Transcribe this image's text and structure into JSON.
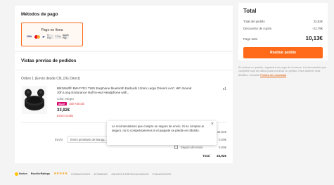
{
  "payment": {
    "title": "Métodos de pago",
    "option_label": "Pago en línea",
    "logos": [
      "VISA",
      "mastercard",
      "P",
      "G Pay",
      "C Pay",
      "Apple Pay"
    ]
  },
  "preview": {
    "title": "Vistas previas de pedidos",
    "order_title": "Orden 1 (Envío desde CN_DG Direct)",
    "product": {
      "name": "BlitzWolf® BW-FYE2 TWS Earphone bluetooth Earbuds 13mm Large Drivers AAC HiFi Sound 20h Long Endurance Half in-ear Headphone with...",
      "color": "color: Negro",
      "sale_badge": "SALE",
      "stock_left": "150 Artículo",
      "price": "33,92€",
      "shipping": "Envío Gratis",
      "qty": "x1"
    },
    "subtotal_value": "33,92€",
    "shipping_label": "Envío",
    "shipping_method": "Envío prioritario de Bangg...",
    "shipping_cost": "0,00€",
    "insurance_label": "Seguro de envío",
    "insurance_cost": "0,00€",
    "total_label": "Total",
    "total_value": "33,92€"
  },
  "tooltip": {
    "text": "Le recomendamos que compre un seguro de envío. Si no compra un seguro, no lo compensaremos si el paquete se pierde en tránsito.",
    "close": "×"
  },
  "summary": {
    "title": "Total",
    "rows": [
      {
        "label": "Total del pedido",
        "value": "33,92€"
      },
      {
        "label": "Descuento de cupón",
        "value": "-23,79€"
      }
    ],
    "pay_label": "Pago total",
    "pay_value": "10,13€",
    "button": "Realizar pedido"
  },
  "legal": {
    "text": "Al realizar un pedido, ingresará un pago de terceros. La información que complete solo se utiliza para procesar su pedido. Para obtener más detalles, consulte ",
    "link": "Política de privacidad"
  },
  "footer": {
    "norton": "Norton",
    "reseller": "ResellerRatings",
    "stars": "★★★★★",
    "links": [
      "CONDICIONES",
      "INTIMIDAD",
      "ASUNTOS ESPECIALIZADOS",
      "© BANGGOOD"
    ]
  },
  "colors": {
    "accent": "#ff6a1a",
    "sale": "#d6006a",
    "warning": "#e4393c"
  }
}
